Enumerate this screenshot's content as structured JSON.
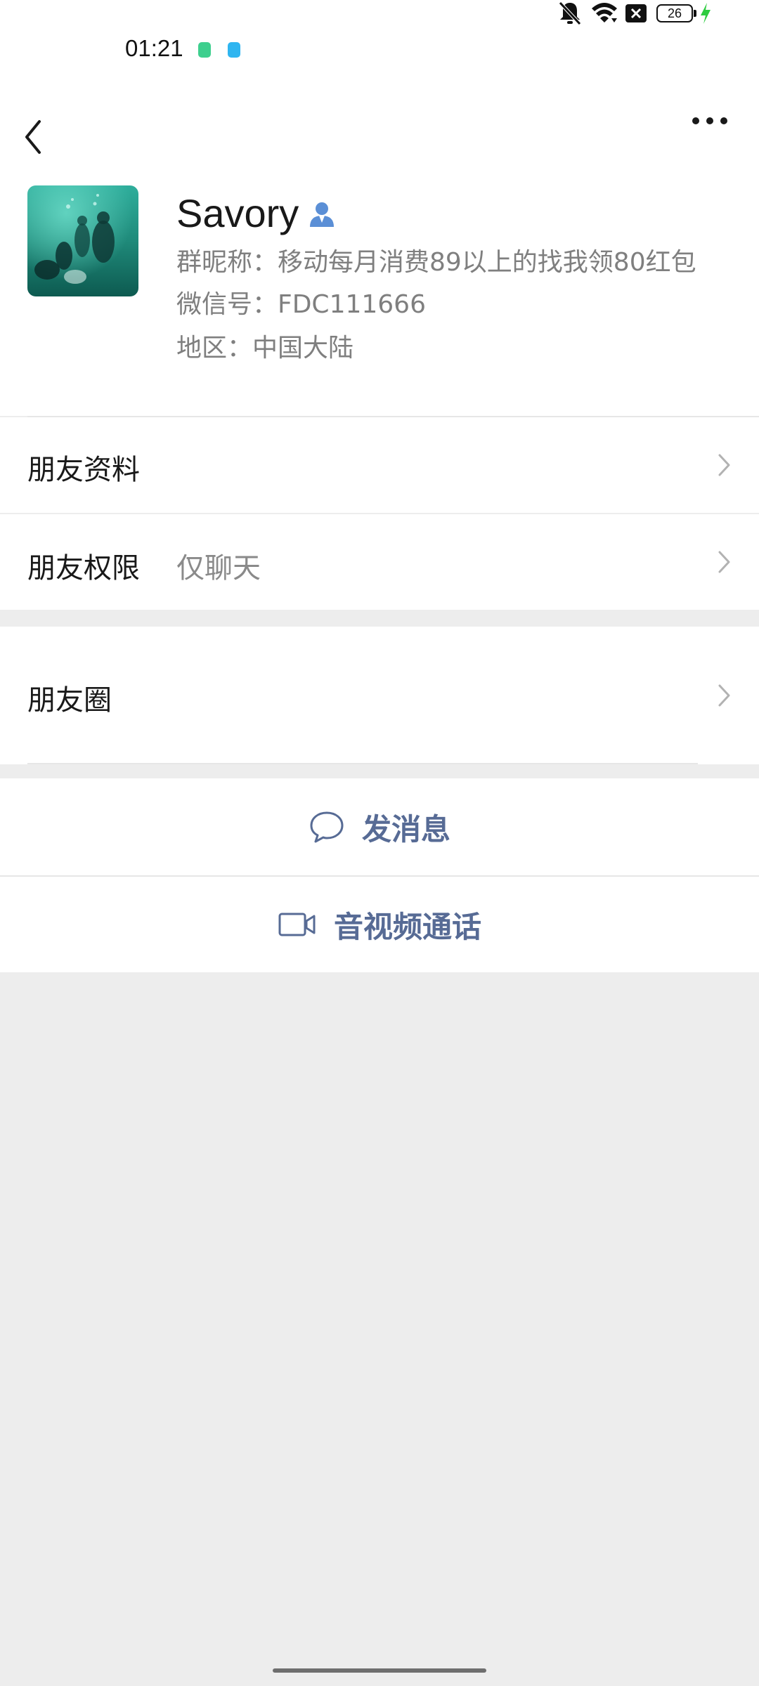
{
  "status_bar": {
    "time": "01:21",
    "battery": "26",
    "icons": [
      "notification-app-icon",
      "notification-app2-icon",
      "mute-icon",
      "wifi-icon",
      "close-box-icon",
      "battery-icon",
      "charging-icon"
    ]
  },
  "nav": {
    "back_icon": "chevron-left-icon",
    "more_icon": "more-dots-icon"
  },
  "profile": {
    "name": "Savory",
    "group_nickname": "群昵称：移动每月消费89以上的找我领80红包",
    "wechat_id": "微信号：FDC111666",
    "region": "地区：中国大陆"
  },
  "rows": {
    "friend_info": "朋友资料",
    "friend_permission": "朋友权限",
    "friend_permission_value": "仅聊天",
    "moments": "朋友圈"
  },
  "actions": {
    "send_message": "发消息",
    "av_call": "音视频通话"
  },
  "colors": {
    "accent": "#576b95",
    "background": "#ededed"
  }
}
